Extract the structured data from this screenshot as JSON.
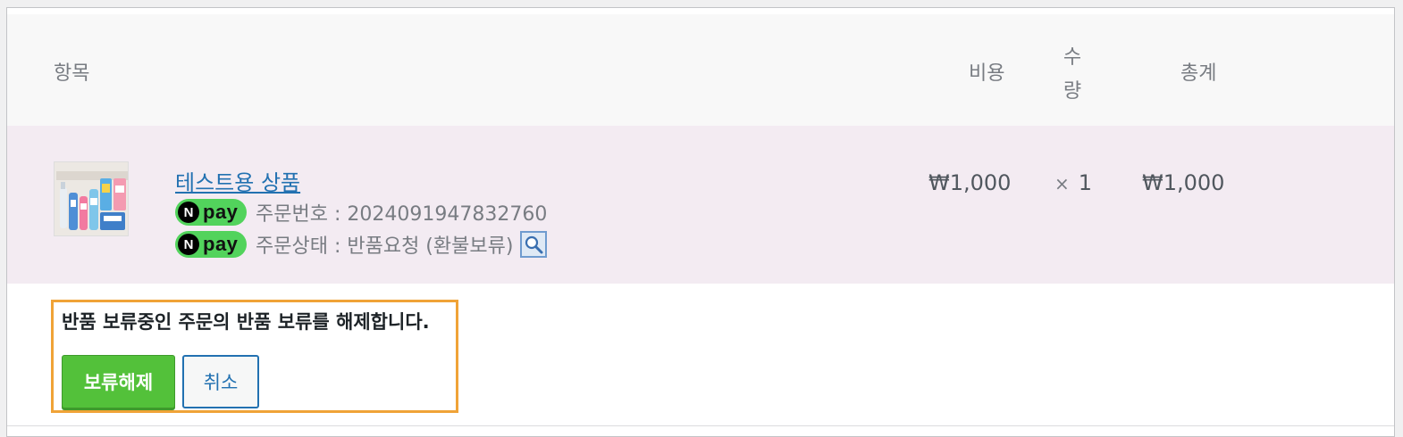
{
  "table": {
    "headers": {
      "item": "항목",
      "cost": "비용",
      "qty_line1": "수",
      "qty_line2": "량",
      "total": "총계"
    }
  },
  "line_item": {
    "product_name": "테스트용 상품",
    "payment_badge": {
      "n": "N",
      "text": "pay",
      "color": "#52d35c"
    },
    "order_number": "주문번호 : 2024091947832760",
    "order_status": "주문상태 : 반품요청 (환불보류)",
    "cost": "₩1,000",
    "qty_symbol": "×",
    "qty": "1",
    "total": "₩1,000"
  },
  "action": {
    "message": "반품 보류중인 주문의 반품 보류를 해제합니다.",
    "release_button": "보류해제",
    "cancel_button": "취소"
  },
  "colors": {
    "row_background": "#f3ebf2",
    "highlight_border": "#f0a337",
    "release_button": "#53c13a",
    "link": "#2271b1"
  }
}
